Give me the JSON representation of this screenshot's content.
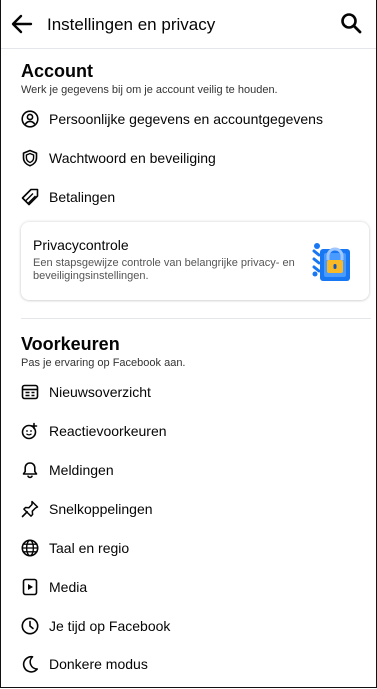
{
  "header": {
    "title": "Instellingen en privacy",
    "back_icon": "arrow-left-icon",
    "search_icon": "search-icon"
  },
  "account": {
    "title": "Account",
    "subtitle": "Werk je gegevens bij om je account veilig te houden.",
    "items": [
      {
        "label": "Persoonlijke gegevens en accountgegevens",
        "icon": "person-circle-icon"
      },
      {
        "label": "Wachtwoord en beveiliging",
        "icon": "shield-icon"
      },
      {
        "label": "Betalingen",
        "icon": "tag-icon"
      }
    ],
    "privacy_card": {
      "title": "Privacycontrole",
      "description": "Een stapsgewijze controle van belangrijke privacy- en beveiligingsinstellingen.",
      "icon": "privacy-lock-illustration"
    }
  },
  "preferences": {
    "title": "Voorkeuren",
    "subtitle": "Pas je ervaring op Facebook aan.",
    "items": [
      {
        "label": "Nieuwsoverzicht",
        "icon": "newsfeed-icon"
      },
      {
        "label": "Reactievoorkeuren",
        "icon": "reaction-icon"
      },
      {
        "label": "Meldingen",
        "icon": "bell-icon"
      },
      {
        "label": "Snelkoppelingen",
        "icon": "pin-icon"
      },
      {
        "label": "Taal en regio",
        "icon": "globe-icon"
      },
      {
        "label": "Media",
        "icon": "media-icon"
      },
      {
        "label": "Je tijd op Facebook",
        "icon": "clock-icon"
      },
      {
        "label": "Donkere modus",
        "icon": "moon-icon"
      }
    ]
  },
  "colors": {
    "accent": "#1877f2",
    "text": "#050505",
    "divider": "#e4e6eb"
  }
}
